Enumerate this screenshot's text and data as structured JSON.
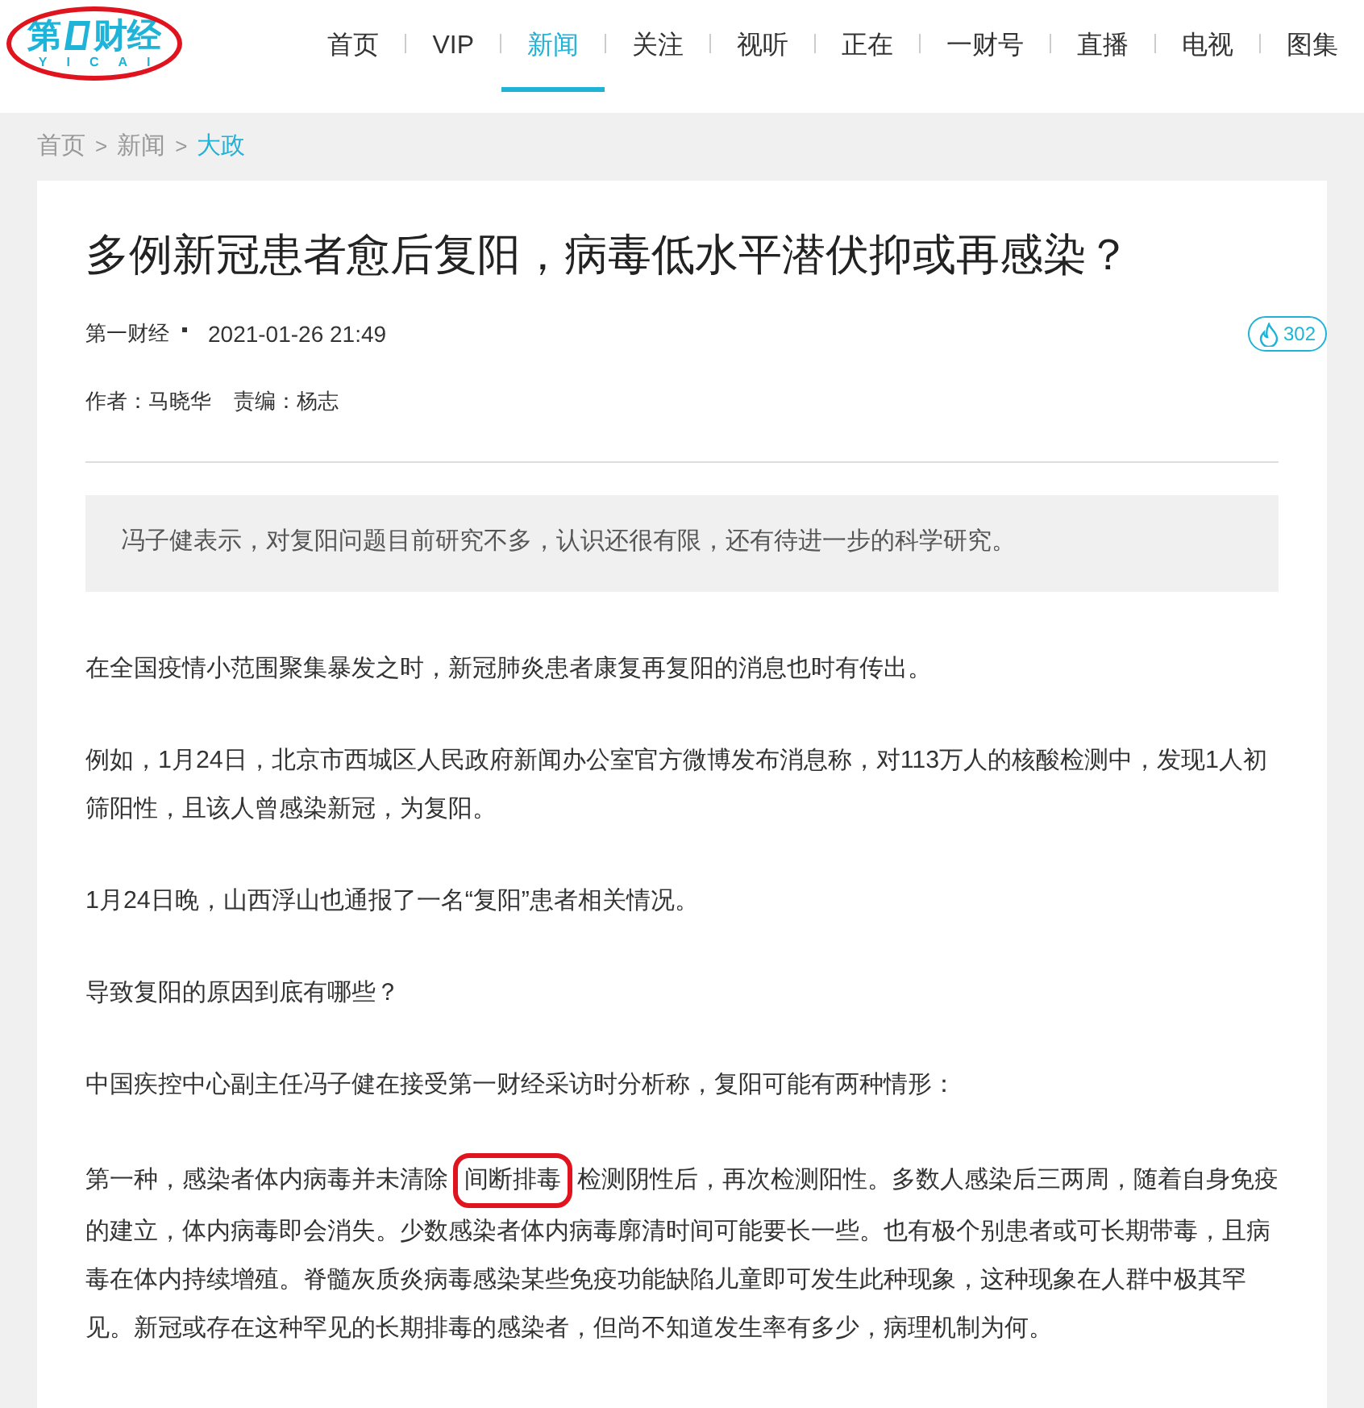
{
  "logo": {
    "left": "第",
    "right": "财经",
    "sub": "YICAI",
    "annotated": true
  },
  "nav": [
    {
      "label": "首页",
      "selected": false
    },
    {
      "label": "VIP",
      "selected": false
    },
    {
      "label": "新闻",
      "selected": true
    },
    {
      "label": "关注",
      "selected": false
    },
    {
      "label": "视听",
      "selected": false
    },
    {
      "label": "正在",
      "selected": false
    },
    {
      "label": "一财号",
      "selected": false
    },
    {
      "label": "直播",
      "selected": false
    },
    {
      "label": "电视",
      "selected": false
    },
    {
      "label": "图集",
      "selected": false
    }
  ],
  "breadcrumb": [
    {
      "label": "首页",
      "selected": false
    },
    {
      "label": "新闻",
      "selected": false
    },
    {
      "label": "大政",
      "selected": true
    }
  ],
  "breadcrumb_separator": ">",
  "article": {
    "title": "多例新冠患者愈后复阳，病毒低水平潜伏抑或再感染？",
    "source": "第一财经",
    "time": "2021-01-26 21:49",
    "heat": "302",
    "byline": [
      "作者：马晓华",
      "责编：杨志"
    ],
    "summary": "冯子健表示，对复阳问题目前研究不多，认识还很有限，还有待进一步的科学研究。",
    "paragraphs": [
      {
        "text": "在全国疫情小范围聚集暴发之时，新冠肺炎患者康复再复阳的消息也时有传出。"
      },
      {
        "text": "例如，1月24日，北京市西城区人民政府新闻办公室官方微博发布消息称，对113万人的核酸检测中，发现1人初筛阳性，且该人曾感染新冠，为复阳。"
      },
      {
        "text": "1月24日晚，山西浮山也通报了一名“复阳”患者相关情况。"
      },
      {
        "text": "导致复阳的原因到底有哪些？"
      },
      {
        "text": "中国疾控中心副主任冯子健在接受第一财经采访时分析称，复阳可能有两种情形："
      },
      {
        "text": "第一种，感染者体内病毒并未清除",
        "annotated": "间断排毒",
        "after": "检测阴性后，再次检测阳性。多数人感染后三两周，随着自身免疫的建立，体内病毒即会消失。少数感染者体内病毒廓清时间可能要长一些。也有极个别患者或可长期带毒，且病毒在体内持续增殖。脊髓灰质炎病毒感染某些免疫功能缺陷儿童即可发生此种现象，这种现象在人群中极其罕见。新冠或存在这种罕见的长期排毒的感染者，但尚不知道发生率有多少，病理机制为何。"
      }
    ]
  }
}
